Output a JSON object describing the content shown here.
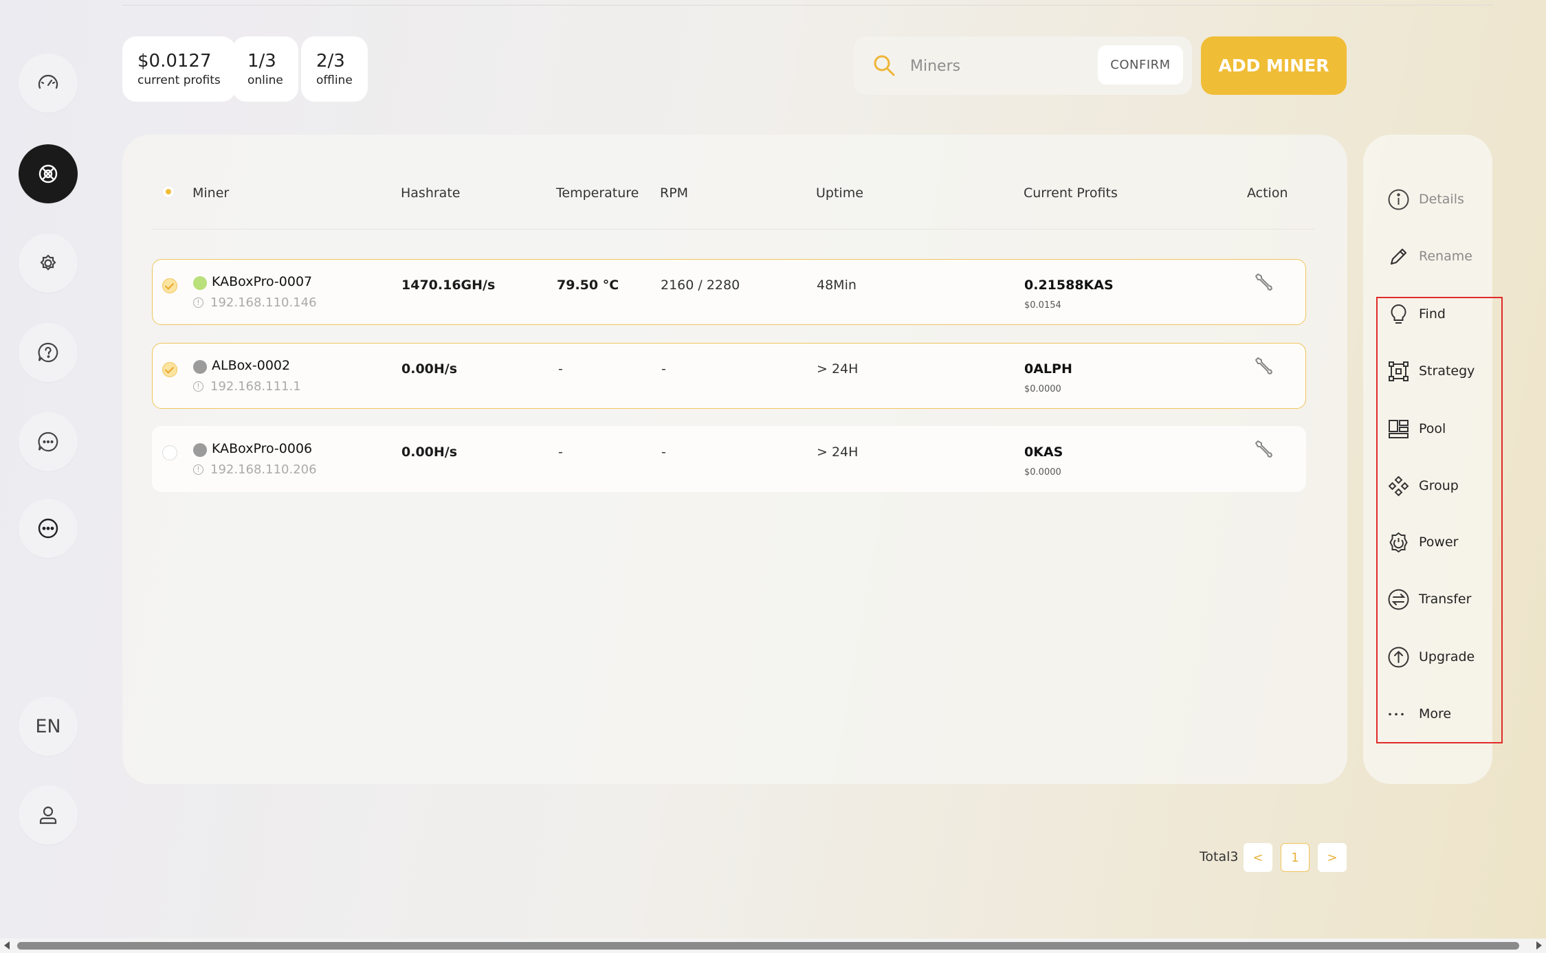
{
  "stats": [
    {
      "value": "$0.0127",
      "label": "current profits"
    },
    {
      "value": "1/3",
      "label": "online"
    },
    {
      "value": "2/3",
      "label": "offline"
    }
  ],
  "search": {
    "placeholder": "Miners",
    "confirm_label": "CONFIRM"
  },
  "add_miner_label": "ADD MINER",
  "nav": {
    "items": [
      "speedometer-icon",
      "miner-icon",
      "settings-icon",
      "help-icon",
      "chat-icon",
      "more-icon"
    ],
    "active": "miner-icon",
    "language": "EN"
  },
  "table": {
    "headers": {
      "miner": "Miner",
      "hashrate": "Hashrate",
      "temperature": "Temperature",
      "rpm": "RPM",
      "uptime": "Uptime",
      "profits": "Current Profits",
      "action": "Action"
    },
    "rows": [
      {
        "name": "KABoxPro-0007",
        "ip": "192.168.110.146",
        "status": "online",
        "selected": true,
        "hashrate": "1470.16GH/s",
        "temperature": "79.50 °C",
        "rpm": "2160 / 2280",
        "uptime": "48Min",
        "profit": "0.21588KAS",
        "profit_usd": "$0.0154"
      },
      {
        "name": "ALBox-0002",
        "ip": "192.168.111.1",
        "status": "offline",
        "selected": true,
        "hashrate": "0.00H/s",
        "temperature": "-",
        "rpm": "-",
        "uptime": "> 24H",
        "profit": "0ALPH",
        "profit_usd": "$0.0000"
      },
      {
        "name": "KABoxPro-0006",
        "ip": "192.168.110.206",
        "status": "offline",
        "selected": false,
        "hashrate": "0.00H/s",
        "temperature": "-",
        "rpm": "-",
        "uptime": "> 24H",
        "profit": "0KAS",
        "profit_usd": "$0.0000"
      }
    ]
  },
  "actions": [
    {
      "label": "Details",
      "icon": "info-icon",
      "enabled": false
    },
    {
      "label": "Rename",
      "icon": "pencil-icon",
      "enabled": false
    },
    {
      "label": "Find",
      "icon": "lightbulb-icon",
      "enabled": true
    },
    {
      "label": "Strategy",
      "icon": "strategy-icon",
      "enabled": true
    },
    {
      "label": "Pool",
      "icon": "pool-icon",
      "enabled": true
    },
    {
      "label": "Group",
      "icon": "group-icon",
      "enabled": true
    },
    {
      "label": "Power",
      "icon": "power-icon",
      "enabled": true
    },
    {
      "label": "Transfer",
      "icon": "transfer-icon",
      "enabled": true
    },
    {
      "label": "Upgrade",
      "icon": "upgrade-icon",
      "enabled": true
    },
    {
      "label": "More",
      "icon": "more-dots-icon",
      "enabled": true
    }
  ],
  "pagination": {
    "total_label": "Total3",
    "current_page": "1",
    "prev": "<",
    "next": ">"
  },
  "colors": {
    "accent": "#f0bd37",
    "online": "#b9e07a",
    "offline": "#9b9b9b",
    "highlight": "#e02a2a"
  }
}
